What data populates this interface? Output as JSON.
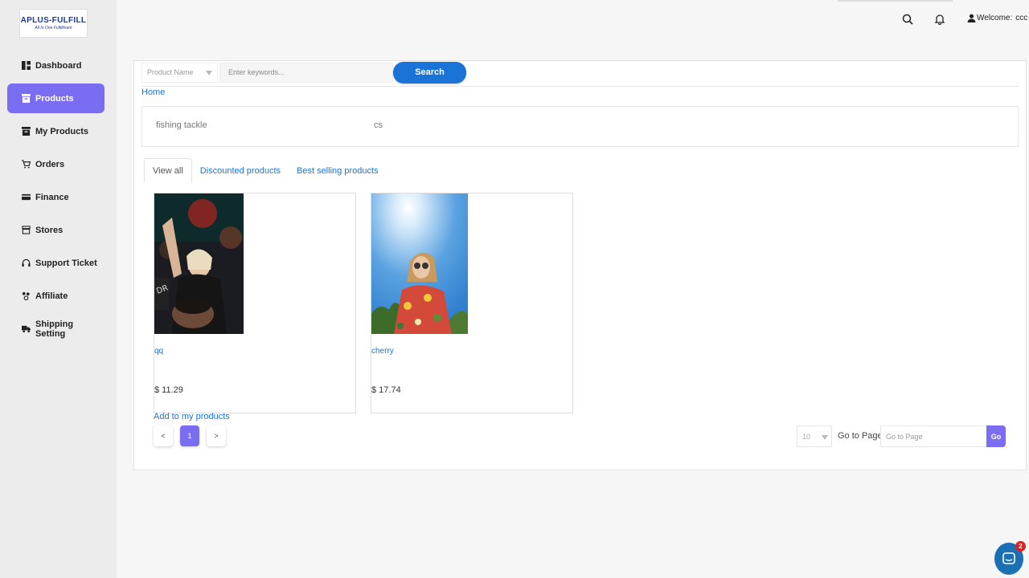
{
  "brand": {
    "name": "APLUS-FULFILL",
    "tagline": "All In One Fulfillment",
    "color": "#1b3a9c"
  },
  "sidebar": {
    "items": [
      {
        "label": "Dashboard",
        "icon": "dashboard-icon"
      },
      {
        "label": "Products",
        "icon": "box-icon",
        "active": true
      },
      {
        "label": "My Products",
        "icon": "box-icon"
      },
      {
        "label": "Orders",
        "icon": "cart-icon"
      },
      {
        "label": "Finance",
        "icon": "card-icon"
      },
      {
        "label": "Stores",
        "icon": "store-icon"
      },
      {
        "label": "Support Ticket",
        "icon": "headset-icon"
      },
      {
        "label": "Affiliate",
        "icon": "affiliate-icon"
      },
      {
        "label": "Shipping Setting",
        "icon": "truck-icon"
      }
    ]
  },
  "header": {
    "welcome_label": "Welcome:",
    "username": "ccc"
  },
  "search": {
    "field_select": "Product Name",
    "keyword_placeholder": "Enter keywords...",
    "button_label": "Search"
  },
  "breadcrumb": {
    "home": "Home"
  },
  "categories": [
    "fishing tackle",
    "cs"
  ],
  "tabs": [
    {
      "label": "View all",
      "active": true
    },
    {
      "label": "Discounted products"
    },
    {
      "label": "Best selling products"
    }
  ],
  "products": [
    {
      "name": "qq",
      "price": "$ 11.29"
    },
    {
      "name": "cherry",
      "price": "$ 17.74"
    }
  ],
  "actions": {
    "add_to_my_products": "Add to my products"
  },
  "pagination": {
    "prev": "<",
    "current": "1",
    "next": ">",
    "page_size": "10",
    "goto_label": "Go to Page",
    "goto_placeholder": "Go to Page",
    "go_button": "Go"
  },
  "chat": {
    "badge_count": "2"
  },
  "colors": {
    "accent": "#7b6df2",
    "link": "#1a74d8",
    "search_button": "#1a74d8"
  }
}
